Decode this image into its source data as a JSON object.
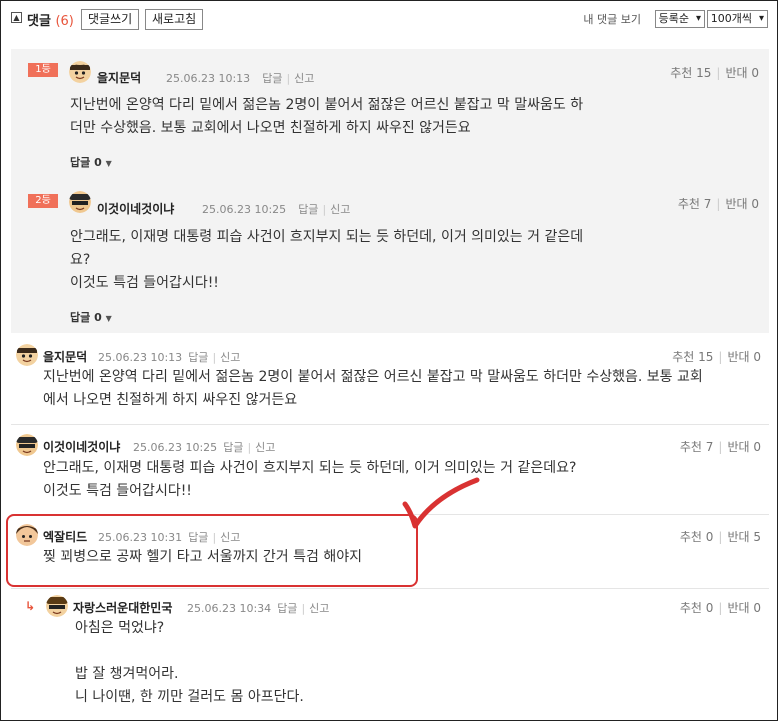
{
  "header": {
    "toggle_icon": "collapse-icon",
    "title": "댓글",
    "count": "(6)",
    "write_button": "댓글쓰기",
    "refresh_button": "새로고침",
    "my_comments": "내 댓글 보기",
    "sort_select": "등록순",
    "per_page_select": "100개씩"
  },
  "best": [
    {
      "rank": "1등",
      "author": "을지문덕",
      "datetime": "25.06.23 10:13",
      "reply_link": "답글",
      "report_link": "신고",
      "upvote": "추천 15",
      "downvote": "반대 0",
      "lines": [
        "지난번에 온양역 다리 밑에서 젊은놈 2명이 붙어서 젊잖은 어르신 붙잡고 막 말싸움도 하",
        "더만 수상했음. 보통 교회에서 나오면 친절하게 하지 싸우진 않거든요"
      ],
      "reply_count": "답글 0"
    },
    {
      "rank": "2등",
      "author": "이것이네것이냐",
      "datetime": "25.06.23 10:25",
      "reply_link": "답글",
      "report_link": "신고",
      "upvote": "추천 7",
      "downvote": "반대 0",
      "lines": [
        "안그래도, 이재명 대통령 피습 사건이 흐지부지 되는 듯 하던데, 이거 의미있는 거 같은데",
        "요?",
        "이것도 특검 들어갑시다!!"
      ],
      "reply_count": "답글 0"
    }
  ],
  "comments": [
    {
      "author": "을지문덕",
      "datetime": "25.06.23 10:13",
      "reply_link": "답글",
      "report_link": "신고",
      "upvote": "추천 15",
      "downvote": "반대 0",
      "lines": [
        "지난번에 온양역 다리 밑에서 젊은놈 2명이 붙어서 젊잖은 어르신 붙잡고 막 말싸움도 하더만 수상했음. 보통 교회",
        "에서 나오면 친절하게 하지 싸우진 않거든요"
      ]
    },
    {
      "author": "이것이네것이냐",
      "datetime": "25.06.23 10:25",
      "reply_link": "답글",
      "report_link": "신고",
      "upvote": "추천 7",
      "downvote": "반대 0",
      "lines": [
        "안그래도, 이재명 대통령 피습 사건이 흐지부지 되는 듯 하던데, 이거 의미있는 거 같은데요?",
        "이것도 특검 들어갑시다!!"
      ]
    },
    {
      "author": "엑잘티드",
      "datetime": "25.06.23 10:31",
      "reply_link": "답글",
      "report_link": "신고",
      "upvote": "추천 0",
      "downvote": "반대 5",
      "lines": [
        "찢 꾀병으로 공짜 헬기 타고 서울까지 간거 특검 해야지"
      ]
    },
    {
      "author": "자랑스러운대한민국",
      "datetime": "25.06.23 10:34",
      "reply_link": "답글",
      "report_link": "신고",
      "upvote": "추천 0",
      "downvote": "반대 0",
      "lines": [
        "아침은 먹었냐?",
        "",
        "밥 잘 챙겨먹어라.",
        "니 나이땐, 한 끼만 걸러도 몸 아프단다."
      ],
      "reply_arrow": "↳"
    }
  ],
  "colors": {
    "accent": "#e8553c",
    "rank_badge": "#f07059",
    "highlight": "#d93232",
    "best_bg": "#f3f3f3"
  }
}
